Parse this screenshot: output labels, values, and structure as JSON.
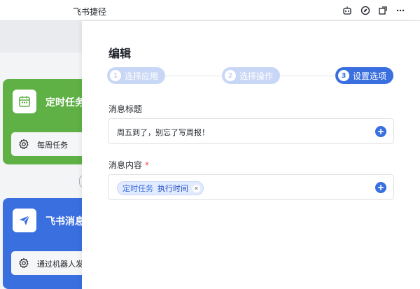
{
  "window": {
    "title": "飞书捷径"
  },
  "titlebar_icons": [
    "robot-icon",
    "compass-icon",
    "window-icon",
    "more-icon"
  ],
  "canvas": {
    "cards": [
      {
        "title": "定时任务",
        "sub_label": "每周任务",
        "color": "#5fb045",
        "icon": "calendar-icon"
      },
      {
        "title": "飞书消息",
        "sub_label": "通过机器人发",
        "color": "#3a6fe0",
        "icon": "paper-plane-icon"
      }
    ]
  },
  "panel": {
    "title": "编辑",
    "steps": [
      {
        "num": "1",
        "label": "选择应用",
        "state": "inactive"
      },
      {
        "num": "2",
        "label": "选择操作",
        "state": "inactive"
      },
      {
        "num": "3",
        "label": "设置选项",
        "state": "active"
      }
    ],
    "message_title": {
      "label": "消息标题",
      "value": "周五到了，别忘了写周报！"
    },
    "message_content": {
      "label": "消息内容",
      "required_mark": "*",
      "tag": {
        "source": "定时任务",
        "field": "执行时间"
      }
    }
  },
  "colors": {
    "accent": "#3a6fe0",
    "green": "#5fb045",
    "required": "#f54a45"
  }
}
